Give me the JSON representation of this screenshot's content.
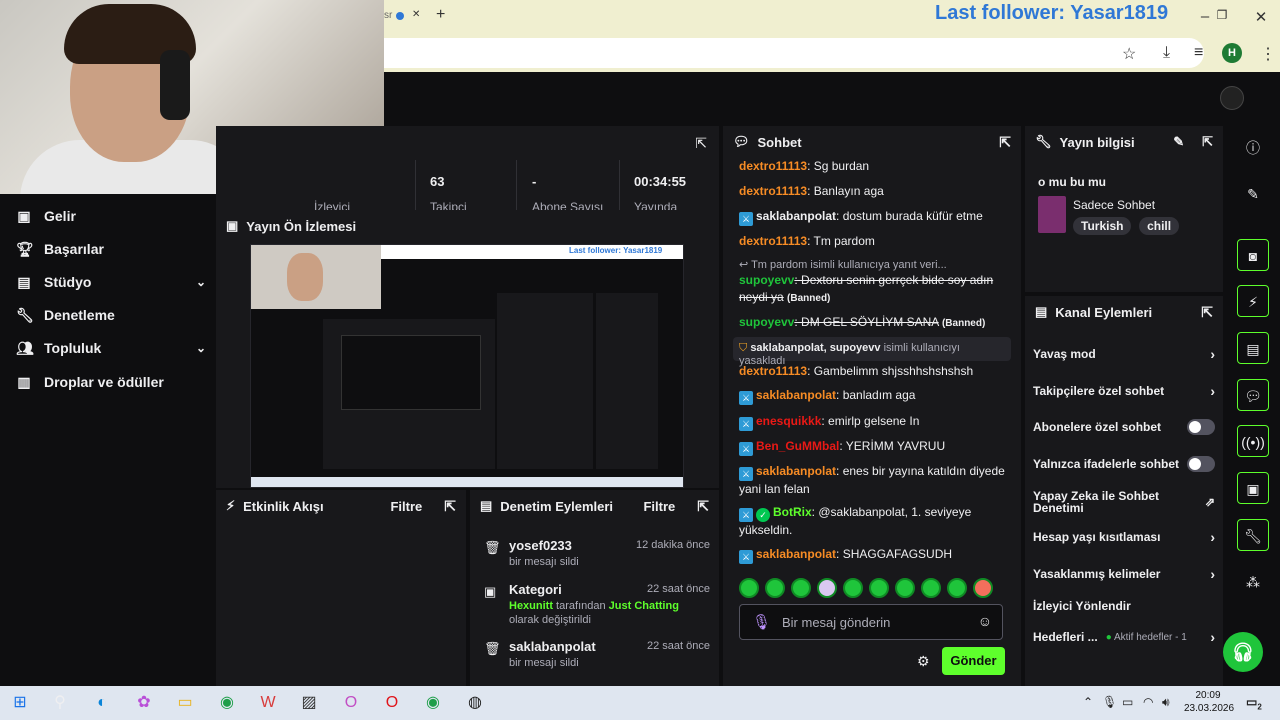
{
  "browser": {
    "tab_fragment": "sr",
    "new_tab": "+",
    "profile_initial": "H"
  },
  "overlay": {
    "last_follower": "Last follower: Yasar1819"
  },
  "leftnav": {
    "items": [
      {
        "label": "Gelir",
        "icon": "income-icon"
      },
      {
        "label": "Başarılar",
        "icon": "trophy-icon"
      },
      {
        "label": "Stüdyo",
        "icon": "studio-icon"
      },
      {
        "label": "Denetleme",
        "icon": "wrench-icon"
      },
      {
        "label": "Topluluk",
        "icon": "community-icon"
      },
      {
        "label": "Droplar ve ödüller",
        "icon": "drops-icon"
      }
    ]
  },
  "stats": {
    "items": [
      {
        "value": "63",
        "label": "Takipçi"
      },
      {
        "value": "-",
        "label": "Abone Sayısı"
      },
      {
        "value": "00:34:55",
        "label": "Yayında"
      }
    ],
    "partial_label": "İzleyici"
  },
  "preview": {
    "title": "Yayın Ön İzlemesi",
    "mini_follower": "Last follower: Yasar1819"
  },
  "activity": {
    "title": "Etkinlik Akışı",
    "filter": "Filtre"
  },
  "modlog": {
    "title": "Denetim Eylemleri",
    "filter": "Filtre",
    "items": [
      {
        "title": "yosef0233",
        "when": "12 dakika önce",
        "desc": "bir mesajı sildi"
      },
      {
        "title": "Kategori",
        "when": "22 saat önce",
        "user": "Hexunitt",
        "mid": " tarafından ",
        "game": "Just Chatting",
        "end": " olarak değiştirildi"
      },
      {
        "title": "saklabanpolat",
        "when": "22 saat önce",
        "desc": "bir mesajı sildi"
      }
    ]
  },
  "chat": {
    "title": "Sohbet",
    "messages": [
      {
        "user": "dextro11113",
        "text": ": Sg burdan"
      },
      {
        "user": "dextro11113",
        "text": ": Banlayın aga"
      },
      {
        "user": "saklabanpolat",
        "text": ": dostum burada küfür etme"
      },
      {
        "user": "dextro11113",
        "text": ": Tm pardom"
      },
      {
        "reply": "Tm pardom isimli kullanıcıya yanıt veri..."
      },
      {
        "user": "supoyevv",
        "text": ": Dextoru senin gerrçek bide soy adın neydi ya",
        "banned": "(Banned)"
      },
      {
        "user": "supoyevv",
        "text": ": DM GEL SÖYLİYM SANA",
        "banned": "(Banned)"
      },
      {
        "system_user": "saklabanpolat",
        "system_target": ", supoyevv",
        "system_text": " isimli kullanıcıyı yasakladı"
      },
      {
        "user": "dextro11113",
        "text": ": Gambelimm shjsshhshshshsh"
      },
      {
        "user": "saklabanpolat",
        "text": ": banladım aga"
      },
      {
        "user": "enesquikkk",
        "text": ": emirlp gelsene In"
      },
      {
        "user": "Ben_GuMMbal",
        "text": ": YERİMM YAVRUU"
      },
      {
        "user": "saklabanpolat",
        "text": ": enes bir yayına katıldın diyede yani lan felan"
      },
      {
        "user": "BotRix",
        "text": ": @saklabanpolat, 1. seviyeye yükseldin."
      },
      {
        "user": "saklabanpolat",
        "text": ": SHAGGAFAGSUDH"
      }
    ],
    "placeholder": "Bir mesaj gönderin",
    "send": "Gönder"
  },
  "streaminfo": {
    "title": "Yayın bilgisi",
    "stream_title": "o mu bu mu",
    "category": "Sadece Sohbet",
    "tags": [
      "Turkish",
      "chill"
    ]
  },
  "actions": {
    "title": "Kanal Eylemleri",
    "items": [
      {
        "label": "Yavaş mod",
        "kind": "arrow"
      },
      {
        "label": "Takipçilere özel sohbet",
        "kind": "arrow"
      },
      {
        "label": "Abonelere özel sohbet",
        "kind": "toggle"
      },
      {
        "label": "Yalnızca ifadelerle sohbet",
        "kind": "toggle"
      },
      {
        "label": "Yapay Zeka ile Sohbet Denetimi",
        "kind": "external"
      },
      {
        "label": "Hesap yaşı kısıtlaması",
        "kind": "arrow"
      },
      {
        "label": "Yasaklanmış kelimeler",
        "kind": "arrow"
      },
      {
        "label": "İzleyici Yönlendir",
        "kind": "none"
      },
      {
        "label": "Hedefleri ...",
        "kind": "arrow",
        "status": "Aktif hedefler - 1"
      }
    ]
  },
  "taskbar": {
    "time": "20:09",
    "date": "23.03.2026",
    "notif_count": "2"
  },
  "colors": {
    "accent_green": "#5eff2c",
    "chat_orange": "#f78c25",
    "mod_blue": "#2e9bd6",
    "bg": "#0e0e10",
    "panel": "#18181b"
  }
}
